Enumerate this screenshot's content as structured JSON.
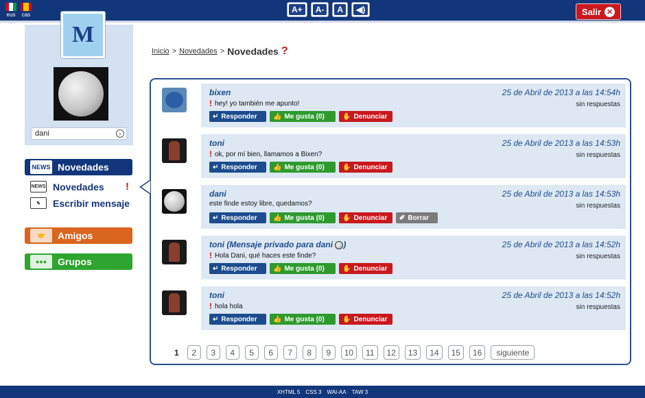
{
  "header": {
    "lang_eus": "eus",
    "lang_cas": "cas",
    "a_plus": "A+",
    "a_minus": "A-",
    "contrast": "A",
    "audio": "◀)",
    "logout": "Salir",
    "logout_icon": "x-circle-icon"
  },
  "colors": {
    "nav_blue": "#12367a",
    "accent_red": "#c9181e",
    "friends_orange": "#d9651e",
    "groups_green": "#2ea52e",
    "message_bg": "#dde8f3"
  },
  "sidebar": {
    "username": "dani",
    "novedades_button": "Novedades",
    "sub_novedades": "Novedades",
    "sub_escribir": "Escribir mensaje",
    "amigos_button": "Amigos",
    "grupos_button": "Grupos",
    "alert_mark": "!"
  },
  "breadcrumb": {
    "inicio": "Inicio",
    "sep1": ">",
    "novedades_link": "Novedades",
    "sep2": ">",
    "current": "Novedades",
    "help": "?"
  },
  "messages": [
    {
      "author": "bixen",
      "recipient": "",
      "text": "hey! yo también me apunto!",
      "date": "25 de Abril de 2013 a las 14:54h",
      "replies": "sin respuestas",
      "avatar": "cookie-monster-avatar"
    },
    {
      "author": "toni",
      "recipient": "",
      "text": "ok, por mí bien, llamamos a Bixen?",
      "date": "25 de Abril de 2013 a las 14:53h",
      "replies": "sin respuestas",
      "avatar": "toni-avatar"
    },
    {
      "author": "dani",
      "recipient": "",
      "text": "este finde estoy libre, quedamos?",
      "date": "25 de Abril de 2013 a las 14:53h",
      "replies": "sin respuestas",
      "avatar": "moon-avatar"
    },
    {
      "author": "toni (Mensaje privado para ",
      "recipient": "dani",
      "closing": ")",
      "text": "Hola Dani, qué haces este finde?",
      "date": "25 de Abril de 2013 a las 14:52h",
      "replies": "sin respuestas",
      "avatar": "toni-avatar"
    },
    {
      "author": "toni",
      "recipient": "",
      "text": "hola hola",
      "date": "25 de Abril de 2013 a las 14:52h",
      "replies": "sin respuestas",
      "avatar": "toni-avatar"
    }
  ],
  "actions": {
    "reply": "Responder",
    "like": "Me gusta (0)",
    "report": "Denunciar",
    "delete": "Borrar"
  },
  "pagination": {
    "current": "1",
    "pages": [
      "2",
      "3",
      "4",
      "5",
      "6",
      "7",
      "8",
      "9",
      "10",
      "11",
      "12",
      "13",
      "14",
      "15",
      "16"
    ],
    "next": "siguiente"
  },
  "footer": [
    "XHTML 5",
    "CSS 3",
    "WAI-AA",
    "TAW 3"
  ]
}
